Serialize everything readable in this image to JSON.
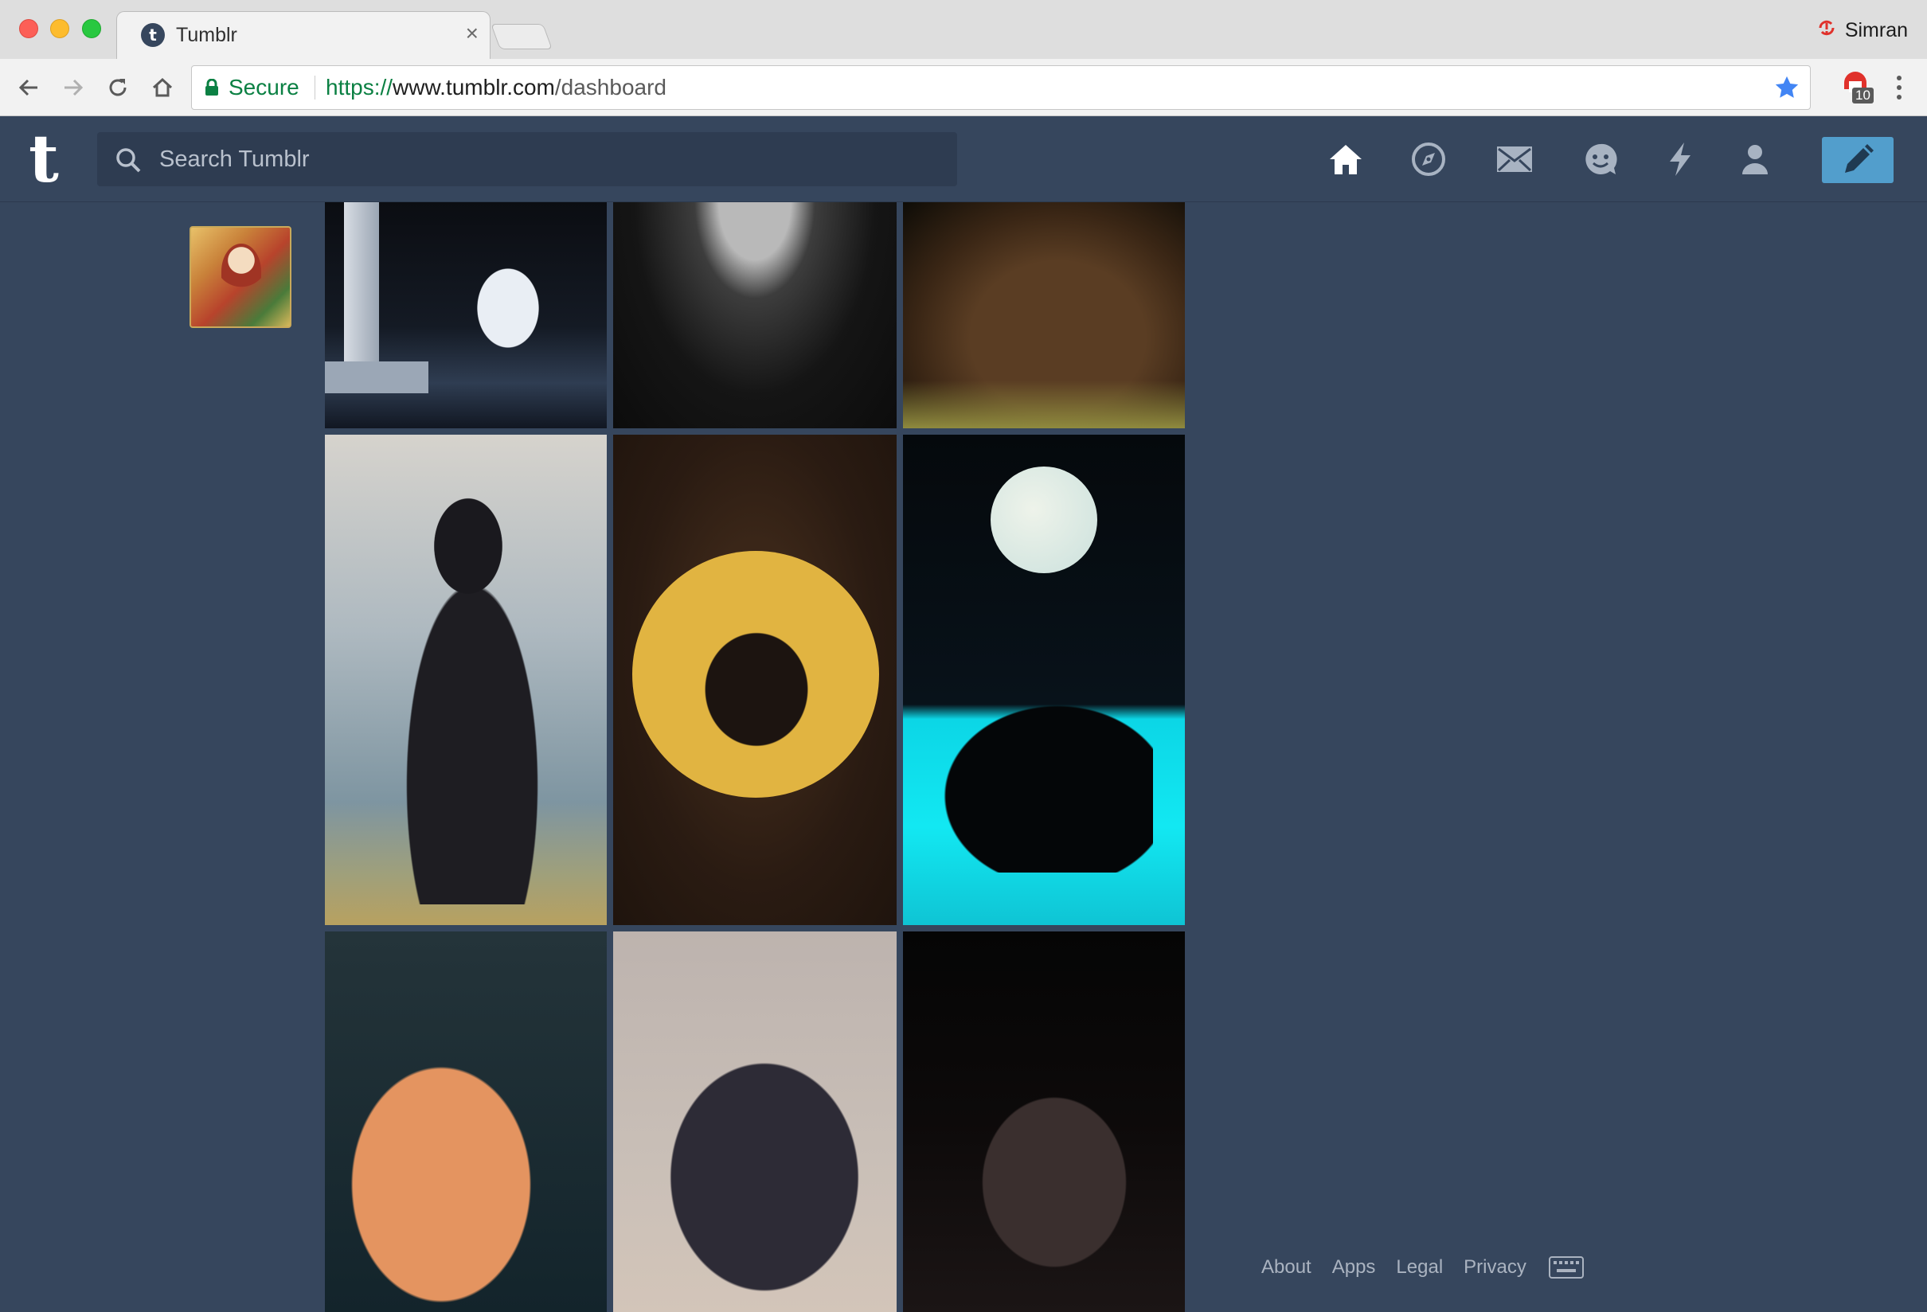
{
  "browser": {
    "tab_title": "Tumblr",
    "tab_close": "×",
    "profile_name": "Simran",
    "secure_label": "Secure",
    "url_scheme": "https://",
    "url_host": "www.tumblr.com",
    "url_path": "/dashboard",
    "extension_badge": "10"
  },
  "header": {
    "logo": "t",
    "search_placeholder": "Search Tumblr",
    "nav_icons": [
      "home-icon",
      "explore-icon",
      "inbox-icon",
      "messaging-icon",
      "activity-icon",
      "account-icon"
    ],
    "compose_icon": "pencil-icon",
    "accent_color": "#529ecc",
    "background_color": "#36465d"
  },
  "dashboard": {
    "avatar": "avatar",
    "posts": [
      "photo-post",
      "photo-post",
      "photo-post",
      "photo-post",
      "photo-post",
      "photo-post",
      "photo-post",
      "photo-post",
      "photo-post"
    ]
  },
  "footer": {
    "links": [
      "About",
      "Apps",
      "Legal",
      "Privacy"
    ],
    "keyboard_icon": "keyboard-icon"
  }
}
